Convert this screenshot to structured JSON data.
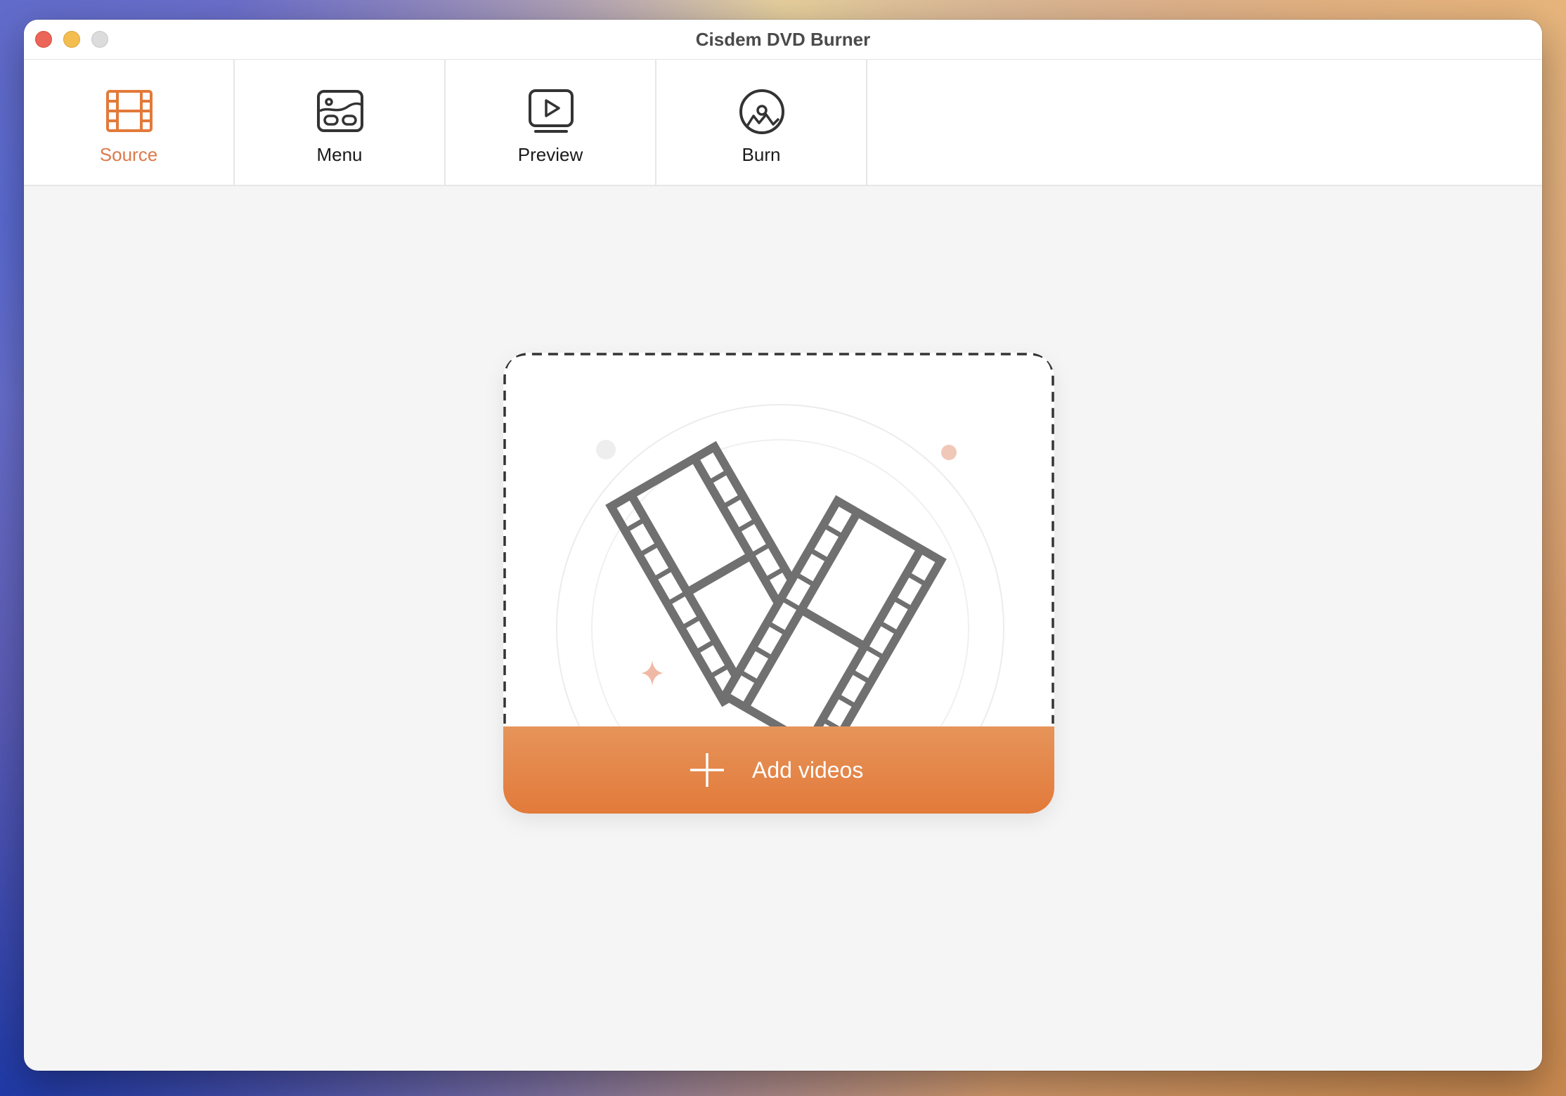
{
  "window": {
    "title": "Cisdem DVD Burner"
  },
  "toolbar": {
    "tabs": [
      {
        "label": "Source",
        "icon": "film-strip-icon",
        "active": true
      },
      {
        "label": "Menu",
        "icon": "menu-template-icon",
        "active": false
      },
      {
        "label": "Preview",
        "icon": "play-monitor-icon",
        "active": false
      },
      {
        "label": "Burn",
        "icon": "disc-burn-icon",
        "active": false
      }
    ]
  },
  "dropzone": {
    "illustration": "film-strips-icon",
    "add_label": "Add videos"
  },
  "colors": {
    "accent": "#e27a3a",
    "accent_text": "#dc7a4a",
    "icon_gray": "#707070",
    "window_bg": "#f5f5f5"
  }
}
